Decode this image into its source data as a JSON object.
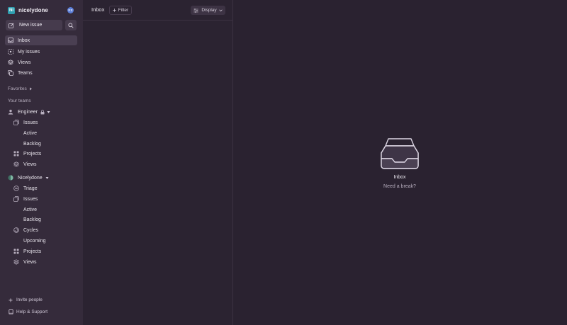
{
  "workspace": {
    "name": "nicelydone",
    "logo_initials": "NI",
    "avatar_initials": "RE"
  },
  "sidebar": {
    "new_issue_label": "New issue",
    "nav": [
      {
        "label": "Inbox",
        "icon": "inbox-icon",
        "active": true
      },
      {
        "label": "My issues",
        "icon": "my-issues-icon"
      },
      {
        "label": "Views",
        "icon": "views-icon"
      },
      {
        "label": "Teams",
        "icon": "teams-icon"
      }
    ],
    "favorites_label": "Favorites",
    "your_teams_label": "Your teams",
    "teams": [
      {
        "name": "Engineer",
        "items": [
          {
            "label": "Issues",
            "icon": "issues-icon",
            "children": [
              "Active",
              "Backlog"
            ]
          },
          {
            "label": "Projects",
            "icon": "projects-icon"
          },
          {
            "label": "Views",
            "icon": "views-icon"
          }
        ]
      },
      {
        "name": "Nicelydone",
        "items": [
          {
            "label": "Triage",
            "icon": "triage-icon"
          },
          {
            "label": "Issues",
            "icon": "issues-icon",
            "children": [
              "Active",
              "Backlog"
            ]
          },
          {
            "label": "Cycles",
            "icon": "cycles-icon",
            "children": [
              "Upcoming"
            ]
          },
          {
            "label": "Projects",
            "icon": "projects-icon"
          },
          {
            "label": "Views",
            "icon": "views-icon"
          }
        ]
      }
    ],
    "invite_label": "Invite people",
    "help_label": "Help & Support"
  },
  "header": {
    "title": "Inbox",
    "filter_label": "Filter",
    "display_label": "Display"
  },
  "empty_state": {
    "title": "Inbox",
    "subtitle": "Need a break?"
  },
  "colors": {
    "sidebar_bg": "#352b3b",
    "main_bg": "#2a2230",
    "active_item_bg": "#4a3f52",
    "workspace_logo": "#2f9fb0",
    "avatar": "#5b7ed8"
  }
}
